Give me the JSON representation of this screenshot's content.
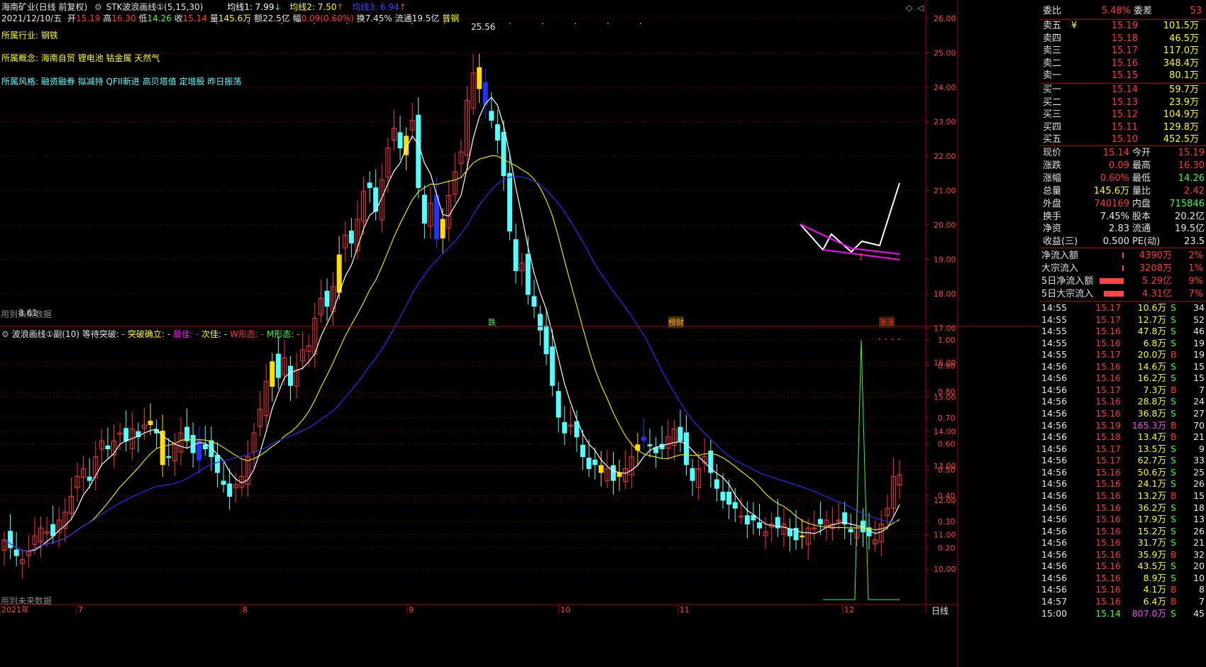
{
  "header": {
    "stock": "海南矿业(日线 前复权)",
    "indicator": "STK波浪画线①(5,15,30)",
    "ma1": "均线1: 7.99",
    "ma2": "均线2: 7.50",
    "ma3": "均线3: 6.94",
    "date": "2021/12/10/五",
    "open_lbl": "开",
    "open": "15.19",
    "high_lbl": "高",
    "high": "16.30",
    "low_lbl": "低",
    "low": "14.26",
    "close_lbl": "收",
    "close": "15.14",
    "vol_lbl": "量",
    "vol": "145.6万",
    "amt": "额22.5亿",
    "chg_lbl": "幅",
    "chg": "0.09(0.60%)",
    "turn": "换7.45%",
    "float": "流通19.5亿",
    "sector": "普钢"
  },
  "info": {
    "industry_k": "所属行业:",
    "industry_v": "钢铁",
    "concept_k": "所属概念:",
    "concept_v": "海南自贸 锂电池 钴金属 天然气",
    "style_k": "所属风格:",
    "style_v": "融资融券 拟减持 QFII新进 高贝塔值 定增股 昨日振荡"
  },
  "main_note": "用到未来数据",
  "main_note_partial": "8.61",
  "peak_label": "25.56",
  "sub_header": {
    "name": "波浪画线①副(10)",
    "wait": "等待突破: -",
    "confirm": "突破确立: -",
    "best": "最佳: -",
    "second": "次佳: -",
    "w": "W形态: -",
    "m": "M形态: -"
  },
  "sub_note": "用到未来数据",
  "markers": {
    "die": "跌",
    "caibao": "榜财",
    "zhang": "涨涨"
  },
  "price_axis": [
    "26.00",
    "25.00",
    "24.00",
    "23.00",
    "22.00",
    "21.00",
    "20.00",
    "19.00",
    "18.00",
    "17.00",
    "16.00",
    "15.00",
    "14.00",
    "13.00",
    "12.00",
    "11.00",
    "10.00"
  ],
  "sub_axis": [
    "1.00",
    "0.90",
    "0.80",
    "0.70",
    "0.60",
    "0.50",
    "0.40",
    "0.30",
    "0.20"
  ],
  "time_axis": [
    "2021年",
    "7",
    "8",
    "9",
    "10",
    "11",
    "12"
  ],
  "period_label": "日线",
  "colors": {
    "up": "#ff3232",
    "down": "#54ffff",
    "ma5": "#ffffff",
    "ma15": "#e6e600",
    "ma30": "#2828ff",
    "wave": "#ff00ff"
  },
  "order_book": {
    "wb_lbl": "委比",
    "wb": "5.48%",
    "wc_lbl": "委差",
    "wc": "53",
    "sells": [
      {
        "lbl": "卖五",
        "price": "15.19",
        "vol": "101.5万"
      },
      {
        "lbl": "卖四",
        "price": "15.18",
        "vol": "46.5万"
      },
      {
        "lbl": "卖三",
        "price": "15.17",
        "vol": "117.0万"
      },
      {
        "lbl": "卖二",
        "price": "15.16",
        "vol": "348.4万"
      },
      {
        "lbl": "卖一",
        "price": "15.15",
        "vol": "80.1万"
      }
    ],
    "buys": [
      {
        "lbl": "买一",
        "price": "15.14",
        "vol": "59.7万"
      },
      {
        "lbl": "买二",
        "price": "15.13",
        "vol": "23.9万"
      },
      {
        "lbl": "买三",
        "price": "15.12",
        "vol": "104.9万"
      },
      {
        "lbl": "买四",
        "price": "15.11",
        "vol": "129.8万"
      },
      {
        "lbl": "买五",
        "price": "15.10",
        "vol": "452.5万"
      }
    ],
    "yen": "¥"
  },
  "quote": [
    {
      "l1": "现价",
      "v1": "15.14",
      "c1": "red",
      "l2": "今开",
      "v2": "15.19",
      "c2": "red"
    },
    {
      "l1": "涨跌",
      "v1": "0.09",
      "c1": "red",
      "l2": "最高",
      "v2": "16.30",
      "c2": "red"
    },
    {
      "l1": "涨幅",
      "v1": "0.60%",
      "c1": "red",
      "l2": "最低",
      "v2": "14.26",
      "c2": "green"
    },
    {
      "l1": "总量",
      "v1": "145.6万",
      "c1": "yel",
      "l2": "量比",
      "v2": "2.42",
      "c2": "red"
    },
    {
      "l1": "外盘",
      "v1": "740169",
      "c1": "red",
      "l2": "内盘",
      "v2": "715846",
      "c2": "green"
    },
    {
      "l1": "换手",
      "v1": "7.45%",
      "c1": "white",
      "l2": "股本",
      "v2": "20.2亿",
      "c2": "white"
    },
    {
      "l1": "净资",
      "v1": "2.83",
      "c1": "white",
      "l2": "流通",
      "v2": "19.5亿",
      "c2": "white"
    },
    {
      "l1": "收益(三)",
      "v1": "0.500",
      "c1": "white",
      "l2": "PE(动)",
      "v2": "23.5",
      "c2": "white"
    }
  ],
  "flows": [
    {
      "lbl": "净流入额",
      "val": "4390万",
      "pct": "2%",
      "bar": 2
    },
    {
      "lbl": "大宗流入",
      "val": "3208万",
      "pct": "1%",
      "bar": 2
    },
    {
      "lbl": "5日净流入额",
      "val": "5.29亿",
      "pct": "9%",
      "bar": 34
    },
    {
      "lbl": "5日大宗流入",
      "val": "4.31亿",
      "pct": "7%",
      "bar": 28
    }
  ],
  "ticks": [
    {
      "t": "14:55",
      "p": "15.17",
      "v": "10.6万",
      "s": "S",
      "n": "34"
    },
    {
      "t": "14:55",
      "p": "15.17",
      "v": "12.7万",
      "s": "S",
      "n": "52"
    },
    {
      "t": "14:55",
      "p": "15.16",
      "v": "47.8万",
      "s": "S",
      "n": "46"
    },
    {
      "t": "14:55",
      "p": "15.16",
      "v": "6.8万",
      "s": "S",
      "n": "19"
    },
    {
      "t": "14:55",
      "p": "15.17",
      "v": "20.0万",
      "s": "B",
      "n": "19"
    },
    {
      "t": "14:56",
      "p": "15.16",
      "v": "14.6万",
      "s": "S",
      "n": "15"
    },
    {
      "t": "14:56",
      "p": "15.16",
      "v": "16.2万",
      "s": "S",
      "n": "15"
    },
    {
      "t": "14:56",
      "p": "15.17",
      "v": "7.3万",
      "s": "B",
      "n": "7"
    },
    {
      "t": "14:56",
      "p": "15.16",
      "v": "28.8万",
      "s": "S",
      "n": "24"
    },
    {
      "t": "14:56",
      "p": "15.16",
      "v": "36.8万",
      "s": "S",
      "n": "27"
    },
    {
      "t": "14:56",
      "p": "15.19",
      "v": "165.3万",
      "s": "B",
      "n": "70"
    },
    {
      "t": "14:56",
      "p": "15.18",
      "v": "13.4万",
      "s": "B",
      "n": "21"
    },
    {
      "t": "14:56",
      "p": "15.17",
      "v": "13.5万",
      "s": "S",
      "n": "9"
    },
    {
      "t": "14:56",
      "p": "15.17",
      "v": "62.7万",
      "s": "S",
      "n": "33"
    },
    {
      "t": "14:56",
      "p": "15.16",
      "v": "50.6万",
      "s": "S",
      "n": "25"
    },
    {
      "t": "14:56",
      "p": "15.16",
      "v": "24.1万",
      "s": "S",
      "n": "26"
    },
    {
      "t": "14:56",
      "p": "15.16",
      "v": "13.2万",
      "s": "B",
      "n": "15"
    },
    {
      "t": "14:56",
      "p": "15.16",
      "v": "36.2万",
      "s": "S",
      "n": "18"
    },
    {
      "t": "14:56",
      "p": "15.16",
      "v": "17.9万",
      "s": "S",
      "n": "13"
    },
    {
      "t": "14:56",
      "p": "15.16",
      "v": "15.2万",
      "s": "S",
      "n": "26"
    },
    {
      "t": "14:56",
      "p": "15.16",
      "v": "31.7万",
      "s": "S",
      "n": "21"
    },
    {
      "t": "14:56",
      "p": "15.16",
      "v": "35.9万",
      "s": "B",
      "n": "32"
    },
    {
      "t": "14:56",
      "p": "15.16",
      "v": "43.5万",
      "s": "S",
      "n": "20"
    },
    {
      "t": "14:56",
      "p": "15.16",
      "v": "8.9万",
      "s": "S",
      "n": "10"
    },
    {
      "t": "14:56",
      "p": "15.16",
      "v": "4.1万",
      "s": "B",
      "n": "8"
    },
    {
      "t": "14:57",
      "p": "15.16",
      "v": "6.4万",
      "s": "B",
      "n": "7"
    },
    {
      "t": "15:00",
      "p": "15.14",
      "v": "807.0万",
      "s": "S",
      "n": "45"
    }
  ]
}
